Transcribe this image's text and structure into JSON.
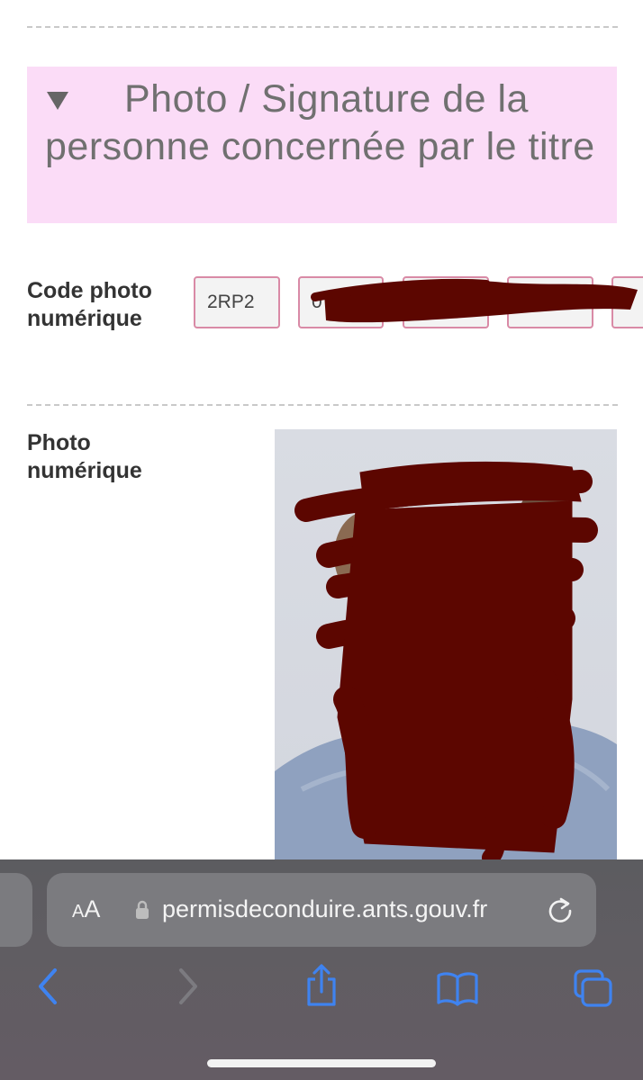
{
  "section": {
    "title": "Photo / Signature de la personne concernée par le titre"
  },
  "fields": {
    "code_label": "Code photo numérique",
    "code_segments": [
      "2RP2",
      "0"
    ],
    "photo_label": "Photo numérique"
  },
  "browser": {
    "text_size_label_small": "A",
    "text_size_label_large": "A",
    "url": "permisdeconduire.ants.gouv.fr"
  },
  "colors": {
    "section_bg": "#fbdcf7",
    "box_border": "#d98aa6",
    "redaction": "#5c0600",
    "toolbar_icon_blue": "#3f83f0"
  },
  "icons": {
    "collapse": "triangle-down-icon",
    "lock": "lock-icon",
    "reload": "reload-icon",
    "back": "chevron-left-icon",
    "forward": "chevron-right-icon",
    "share": "share-icon",
    "bookmarks": "book-icon",
    "tabs": "tabs-icon"
  }
}
